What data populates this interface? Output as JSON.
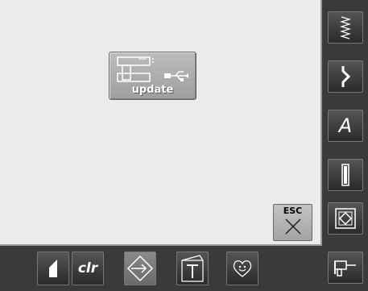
{
  "main": {
    "update_button": {
      "label": "update",
      "icon": "machine-usb-icon"
    },
    "esc_button": {
      "label": "ESC",
      "icon": "close-icon"
    }
  },
  "sidebar": {
    "items": [
      {
        "icon": "zigzag-stitch-icon"
      },
      {
        "icon": "decorative-stitch-icon"
      },
      {
        "label": "A",
        "icon": "alphabet-icon"
      },
      {
        "icon": "buttonhole-icon"
      },
      {
        "icon": "quilt-stitch-icon"
      },
      {
        "icon": "personal-program-icon"
      }
    ]
  },
  "bottom_bar": {
    "items": [
      {
        "icon": "stitch-length-icon"
      },
      {
        "label": "clr",
        "icon": "clear-icon"
      },
      {
        "icon": "setup-icon",
        "active": true
      },
      {
        "icon": "tutorial-icon"
      },
      {
        "icon": "eco-smiley-icon"
      }
    ]
  },
  "colors": {
    "screen_bg": "#ebebeb",
    "frame": "#3a3a3a",
    "button": "#a8a8a8"
  }
}
